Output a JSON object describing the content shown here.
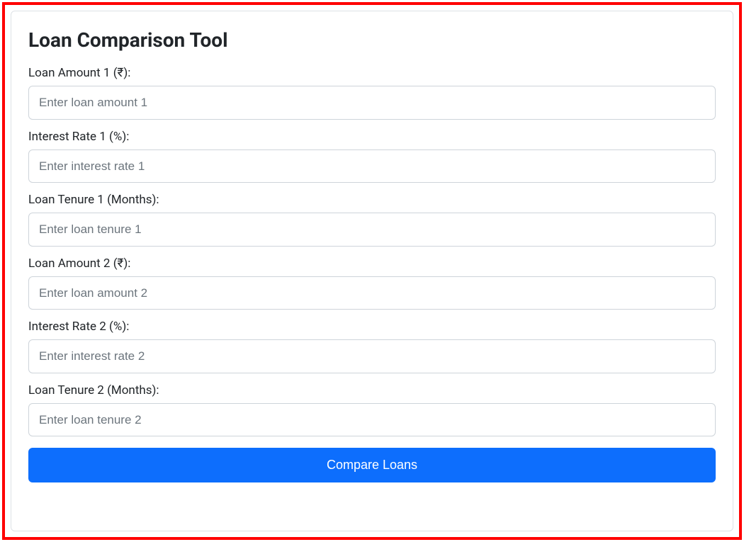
{
  "header": {
    "title": "Loan Comparison Tool"
  },
  "form": {
    "loan1": {
      "amount_label": "Loan Amount 1 (₹):",
      "amount_placeholder": "Enter loan amount 1",
      "rate_label": "Interest Rate 1 (%):",
      "rate_placeholder": "Enter interest rate 1",
      "tenure_label": "Loan Tenure 1 (Months):",
      "tenure_placeholder": "Enter loan tenure 1"
    },
    "loan2": {
      "amount_label": "Loan Amount 2 (₹):",
      "amount_placeholder": "Enter loan amount 2",
      "rate_label": "Interest Rate 2 (%):",
      "rate_placeholder": "Enter interest rate 2",
      "tenure_label": "Loan Tenure 2 (Months):",
      "tenure_placeholder": "Enter loan tenure 2"
    },
    "submit_label": "Compare Loans"
  }
}
